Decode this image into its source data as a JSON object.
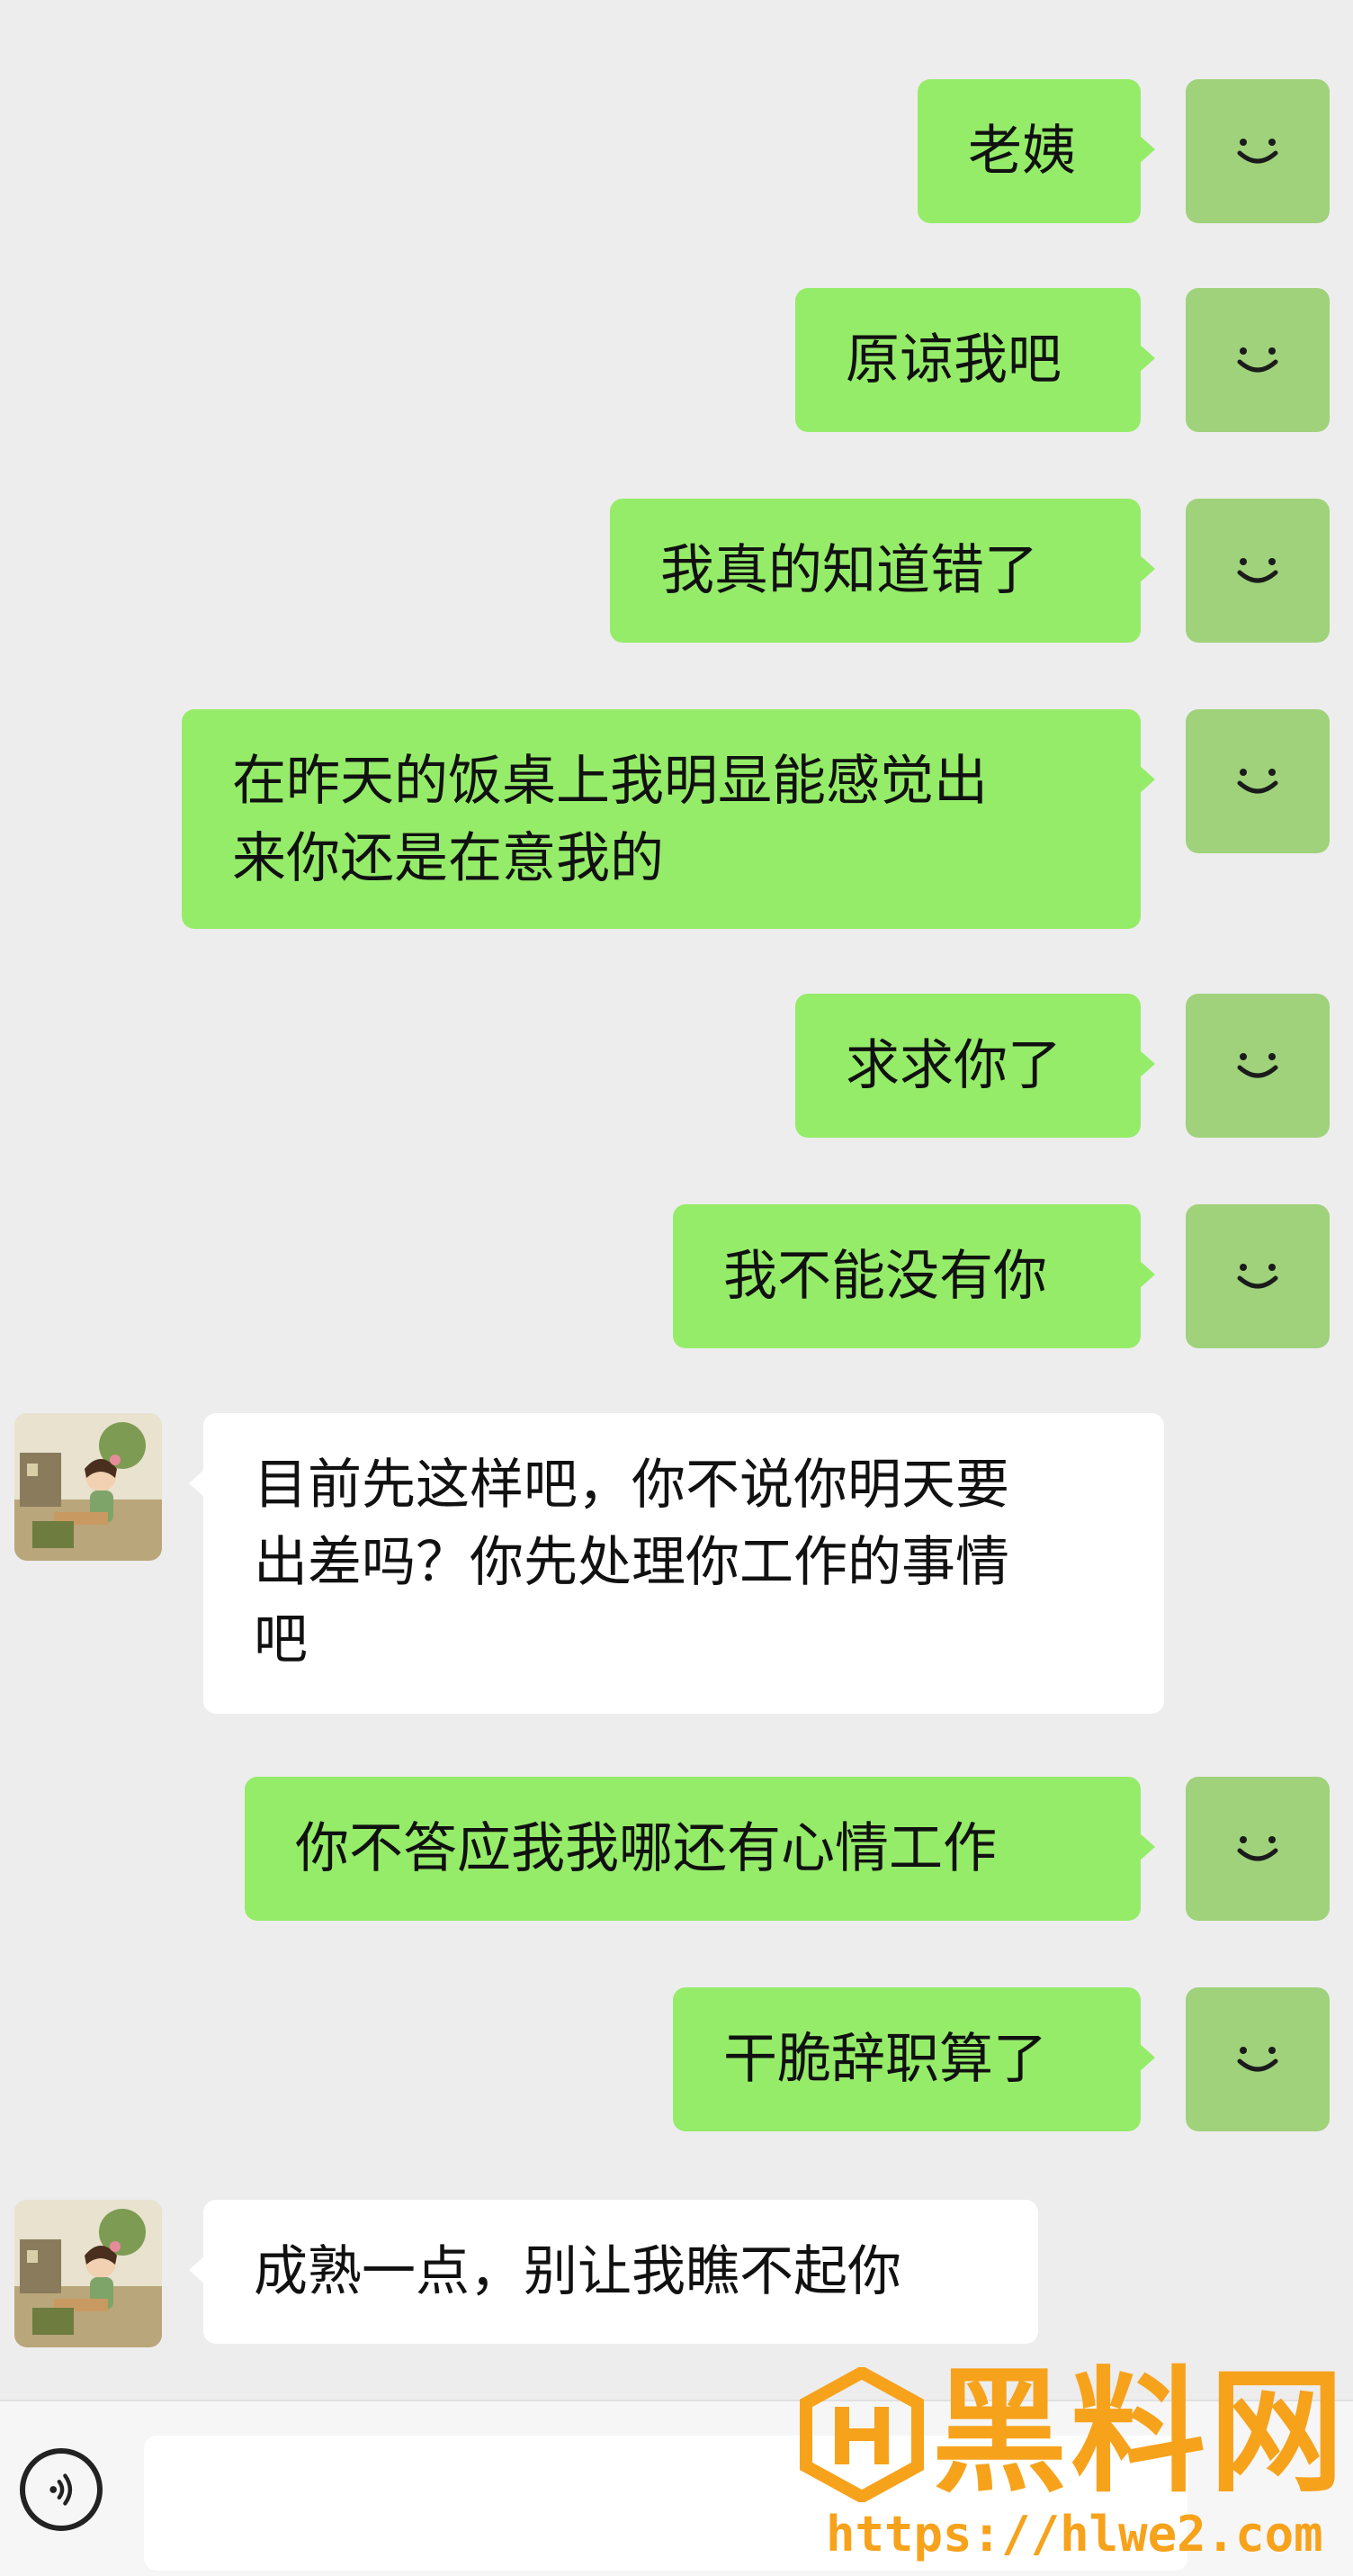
{
  "messages": [
    {
      "side": "me",
      "text": "老姨"
    },
    {
      "side": "me",
      "text": "原谅我吧"
    },
    {
      "side": "me",
      "text": "我真的知道错了"
    },
    {
      "side": "me",
      "text": "在昨天的饭桌上我明显能感觉出\n来你还是在意我的"
    },
    {
      "side": "me",
      "text": "求求你了"
    },
    {
      "side": "me",
      "text": "我不能没有你"
    },
    {
      "side": "other",
      "text": "目前先这样吧，你不说你明天要\n出差吗？你先处理你工作的事情\n吧"
    },
    {
      "side": "me",
      "text": "你不答应我我哪还有心情工作"
    },
    {
      "side": "me",
      "text": "干脆辞职算了"
    },
    {
      "side": "other",
      "text": "成熟一点，别让我瞧不起你"
    }
  ],
  "input": {
    "placeholder": ""
  },
  "watermark": {
    "title": "黑料网",
    "url": "https://hlwe2.com"
  },
  "colors": {
    "my_bubble": "#95ec69",
    "other_bubble": "#ffffff",
    "background": "#ededed",
    "watermark": "#f7a21b"
  },
  "icons": {
    "my_avatar": "smile-icon",
    "voice": "voice-icon"
  }
}
